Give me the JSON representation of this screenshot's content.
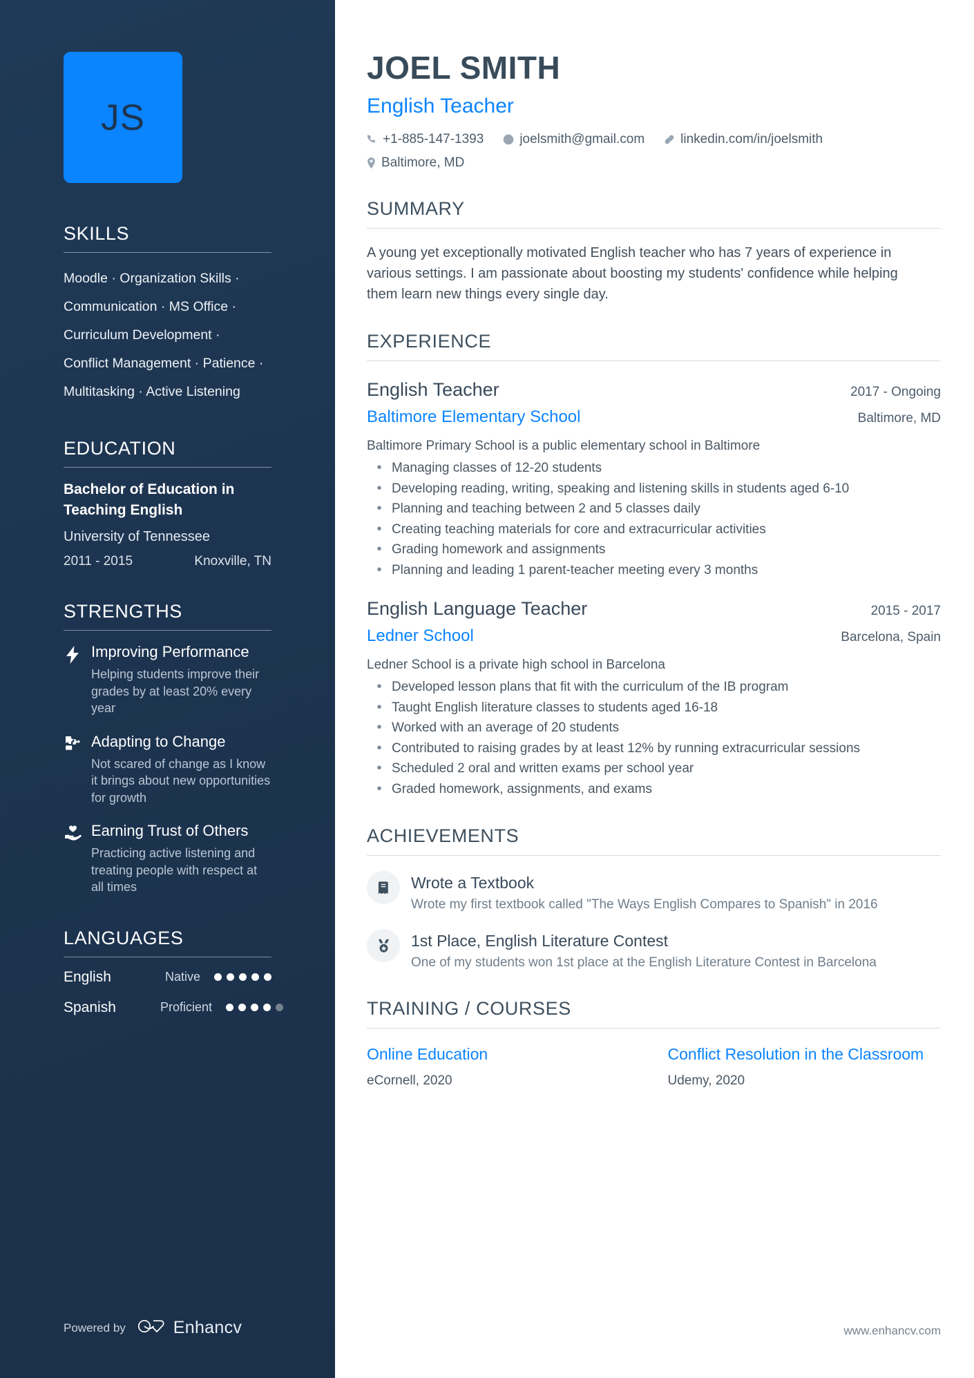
{
  "sidebar": {
    "avatar_initials": "JS",
    "skills": {
      "heading": "SKILLS",
      "lines": [
        "Moodle · Organization Skills ·",
        "Communication · MS Office ·",
        "Curriculum Development ·",
        "Conflict Management · Patience ·",
        "Multitasking · Active Listening"
      ]
    },
    "education": {
      "heading": "EDUCATION",
      "degree": "Bachelor of Education in Teaching English",
      "school": "University of Tennessee",
      "dates": "2011 - 2015",
      "location": "Knoxville, TN"
    },
    "strengths": {
      "heading": "STRENGTHS",
      "items": [
        {
          "icon": "lightning-bolt-icon",
          "title": "Improving Performance",
          "desc": "Helping students improve their grades by at least 20% every year"
        },
        {
          "icon": "puzzle-piece-icon",
          "title": "Adapting to Change",
          "desc": "Not scared of change as I know it brings about new opportunities for growth"
        },
        {
          "icon": "hand-holding-heart-icon",
          "title": "Earning Trust of Others",
          "desc": "Practicing active listening and treating people with respect at all times"
        }
      ]
    },
    "languages": {
      "heading": "LANGUAGES",
      "items": [
        {
          "name": "English",
          "level": "Native",
          "filled": 5,
          "total": 5
        },
        {
          "name": "Spanish",
          "level": "Proficient",
          "filled": 4,
          "total": 5
        }
      ]
    },
    "footer": {
      "powered_by": "Powered by",
      "brand": "Enhancv"
    }
  },
  "header": {
    "name": "JOEL SMITH",
    "role": "English Teacher",
    "contacts": [
      {
        "icon": "phone-icon",
        "text": "+1-885-147-1393"
      },
      {
        "icon": "email-at-icon",
        "text": "joelsmith@gmail.com"
      },
      {
        "icon": "link-icon",
        "text": "linkedin.com/in/joelsmith"
      },
      {
        "icon": "location-pin-icon",
        "text": "Baltimore, MD"
      }
    ]
  },
  "summary": {
    "heading": "SUMMARY",
    "text": "A young yet exceptionally motivated English teacher who has 7 years of experience in various settings. I am passionate about boosting my students' confidence while helping them learn new things every single day."
  },
  "experience": {
    "heading": "EXPERIENCE",
    "jobs": [
      {
        "title": "English Teacher",
        "date": "2017 - Ongoing",
        "company": "Baltimore Elementary School",
        "location": "Baltimore, MD",
        "desc": "Baltimore Primary School is a public elementary school in Baltimore",
        "bullets": [
          "Managing classes of 12-20 students",
          "Developing reading, writing, speaking and listening skills in students aged 6-10",
          "Planning and teaching between 2 and 5 classes daily",
          "Creating teaching materials for core and extracurricular activities",
          "Grading homework and assignments",
          "Planning and leading 1 parent-teacher meeting every 3 months"
        ]
      },
      {
        "title": "English Language Teacher",
        "date": "2015 - 2017",
        "company": "Ledner School",
        "location": "Barcelona, Spain",
        "desc": "Ledner School is a private high school in Barcelona",
        "bullets": [
          "Developed lesson plans that fit with the curriculum of the IB program",
          "Taught English literature classes to students aged 16-18",
          "Worked with an average of 20 students",
          "Contributed to raising grades by at least 12% by running extracurricular sessions",
          "Scheduled 2 oral and written exams per school year",
          "Graded homework, assignments, and exams"
        ]
      }
    ]
  },
  "achievements": {
    "heading": "ACHIEVEMENTS",
    "items": [
      {
        "icon": "book-icon",
        "title": "Wrote a Textbook",
        "desc": "Wrote my first textbook called \"The Ways English Compares to Spanish\" in 2016"
      },
      {
        "icon": "medal-icon",
        "title": "1st Place, English Literature Contest",
        "desc": "One of my students won 1st place at the English Literature Contest in Barcelona"
      }
    ]
  },
  "training": {
    "heading": "TRAINING / COURSES",
    "courses": [
      {
        "name": "Online Education",
        "meta": "eCornell, 2020"
      },
      {
        "name": "Conflict Resolution in the Classroom",
        "meta": "Udemy, 2020"
      }
    ]
  },
  "footer": {
    "website": "www.enhancv.com"
  },
  "colors": {
    "sidebar_bg": "#1d3450",
    "accent_blue": "#0a84ff",
    "heading_gray": "#3d4f5e",
    "body_gray": "#4a5763"
  }
}
